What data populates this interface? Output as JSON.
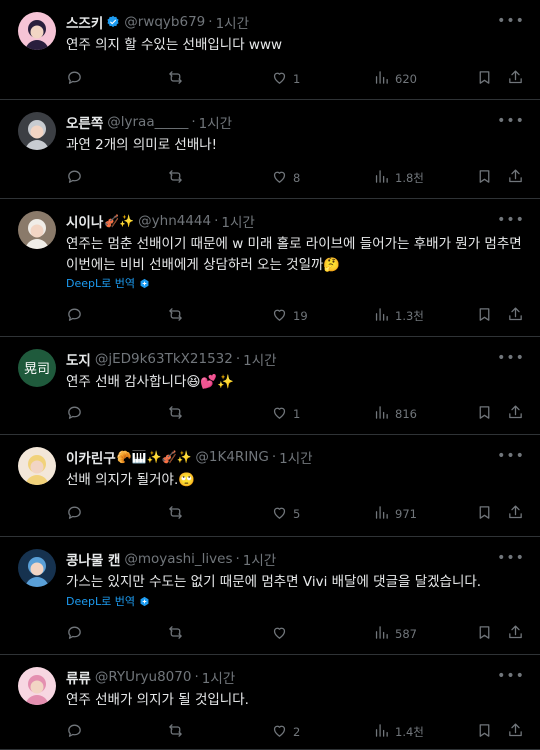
{
  "tweets": [
    {
      "name": "스즈키",
      "verified": true,
      "badge": "",
      "handle": "@rwqyb679",
      "time": "1시간",
      "text": "연주 의지 할 수있는 선배입니다 www",
      "translate": "",
      "replies": "",
      "retweets": "",
      "likes": "1",
      "views": "620",
      "avatar": {
        "bg": "#f6c4d6",
        "hair": "#2a1f3d"
      }
    },
    {
      "name": "오른쪽",
      "verified": false,
      "badge": "",
      "handle": "@lyraa_____",
      "time": "1시간",
      "text": "과연 2개의 의미로 선배나!",
      "translate": "",
      "replies": "",
      "retweets": "",
      "likes": "8",
      "views": "1.8천",
      "avatar": {
        "bg": "#3c3f44",
        "hair": "#c8ccd1"
      }
    },
    {
      "name": "시이나",
      "verified": false,
      "badge": "🎻✨",
      "handle": "@yhn4444",
      "time": "1시간",
      "text": "연주는 멈춘 선배이기 때문에 w 미래 홀로 라이브에 들어가는 후배가 뭔가 멈추면 이번에는 비비 선배에게 상담하러 오는 것일까🤔",
      "translate": "DeepL로 번역",
      "replies": "",
      "retweets": "",
      "likes": "19",
      "views": "1.3천",
      "avatar": {
        "bg": "#8a7a6a",
        "hair": "#f0ede8"
      }
    },
    {
      "name": "도지",
      "verified": false,
      "badge": "",
      "handle": "@jED9k63TkX21532",
      "time": "1시간",
      "text": "연주 선배 감사합니다😆💕✨",
      "translate": "",
      "replies": "",
      "retweets": "",
      "likes": "1",
      "views": "816",
      "avatar": {
        "bg": "#1f5a3c",
        "label": "晃司"
      }
    },
    {
      "name": "이카린구",
      "verified": false,
      "badge": "🥐🎹✨🎻✨",
      "handle": "@1K4RING",
      "time": "1시간",
      "text": "선배 의지가 될거야.🙄",
      "translate": "",
      "replies": "",
      "retweets": "",
      "likes": "5",
      "views": "971",
      "avatar": {
        "bg": "#f3e7d9",
        "hair": "#f1d27a"
      }
    },
    {
      "name": "콩나물 캔",
      "verified": false,
      "badge": "",
      "handle": "@moyashi_lives",
      "time": "1시간",
      "text": "가스는 있지만 수도는 없기 때문에 멈추면 Vivi 배달에 댓글을 달겠습니다.",
      "translate": "DeepL로 번역",
      "replies": "",
      "retweets": "",
      "likes": "",
      "views": "587",
      "avatar": {
        "bg": "#16324f",
        "hair": "#5aa0d8"
      }
    },
    {
      "name": "류류",
      "verified": false,
      "badge": "",
      "handle": "@RYUryu8070",
      "time": "1시간",
      "text": "연주 선배가 의지가 될 것입니다.",
      "translate": "",
      "replies": "",
      "retweets": "",
      "likes": "2",
      "views": "1.4천",
      "avatar": {
        "bg": "#f7d7e2",
        "hair": "#e48fb0"
      }
    }
  ],
  "colors": {
    "accent": "#1d9bf0",
    "muted": "#71767b",
    "text": "#e7e9ea",
    "divider": "#2f3336"
  },
  "icons": [
    "more-icon",
    "reply-icon",
    "retweet-icon",
    "like-icon",
    "views-icon",
    "bookmark-icon",
    "share-icon",
    "verified-badge-icon",
    "globe-icon"
  ]
}
